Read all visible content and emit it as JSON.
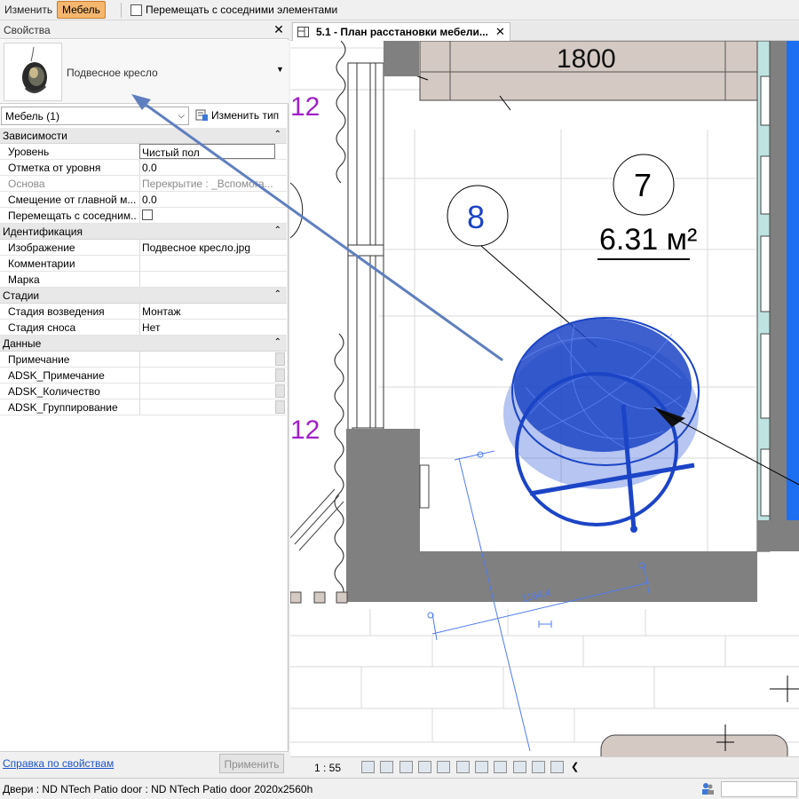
{
  "context_bar": {
    "modify_label": "Изменить",
    "tab_label": "Мебель",
    "move_with_neighbors_label": "Перемещать с соседними элементами"
  },
  "properties": {
    "title": "Свойства",
    "type_name": "Подвесное кресло",
    "filter_value": "Мебель (1)",
    "edit_type_label": "Изменить тип",
    "groups": [
      {
        "name": "Зависимости",
        "rows": [
          {
            "key": "Уровень",
            "value": "Чистый пол"
          },
          {
            "key": "Отметка от уровня",
            "value": "0.0"
          },
          {
            "key": "Основа",
            "value": "Перекрытие : _Вспомога..."
          },
          {
            "key": "Смещение от главной м...",
            "value": "0.0"
          },
          {
            "key": "Перемещать с соседним...",
            "value": ""
          }
        ]
      },
      {
        "name": "Идентификация",
        "rows": [
          {
            "key": "Изображение",
            "value": "Подвесное кресло.jpg"
          },
          {
            "key": "Комментарии",
            "value": ""
          },
          {
            "key": "Марка",
            "value": ""
          }
        ]
      },
      {
        "name": "Стадии",
        "rows": [
          {
            "key": "Стадия возведения",
            "value": "Монтаж"
          },
          {
            "key": "Стадия сноса",
            "value": "Нет"
          }
        ]
      },
      {
        "name": "Данные",
        "rows": [
          {
            "key": "Примечание",
            "value": ""
          },
          {
            "key": "ADSK_Примечание",
            "value": ""
          },
          {
            "key": "ADSK_Количество",
            "value": ""
          },
          {
            "key": "ADSK_Группирование",
            "value": ""
          }
        ]
      }
    ],
    "help_link": "Справка по свойствам",
    "apply_label": "Применить"
  },
  "view": {
    "tab_title": "5.1 - План расстановки мебели...",
    "dim_top": "1800",
    "room_number": "7",
    "room_area": "6.31 м²",
    "tag_number": "8",
    "level_mark_1": "12",
    "level_mark_2": "12",
    "dim_angled": "1164.4",
    "scale": "1 : 55"
  },
  "status_bar": {
    "text": "Двери : ND NTech Patio door : ND NTech Patio door 2020x2560h"
  },
  "colors": {
    "accent_tab": "#f5b66e",
    "furniture_blue": "#1b44c6",
    "wall_gray": "#808080",
    "link_blue": "#1a53c8"
  }
}
